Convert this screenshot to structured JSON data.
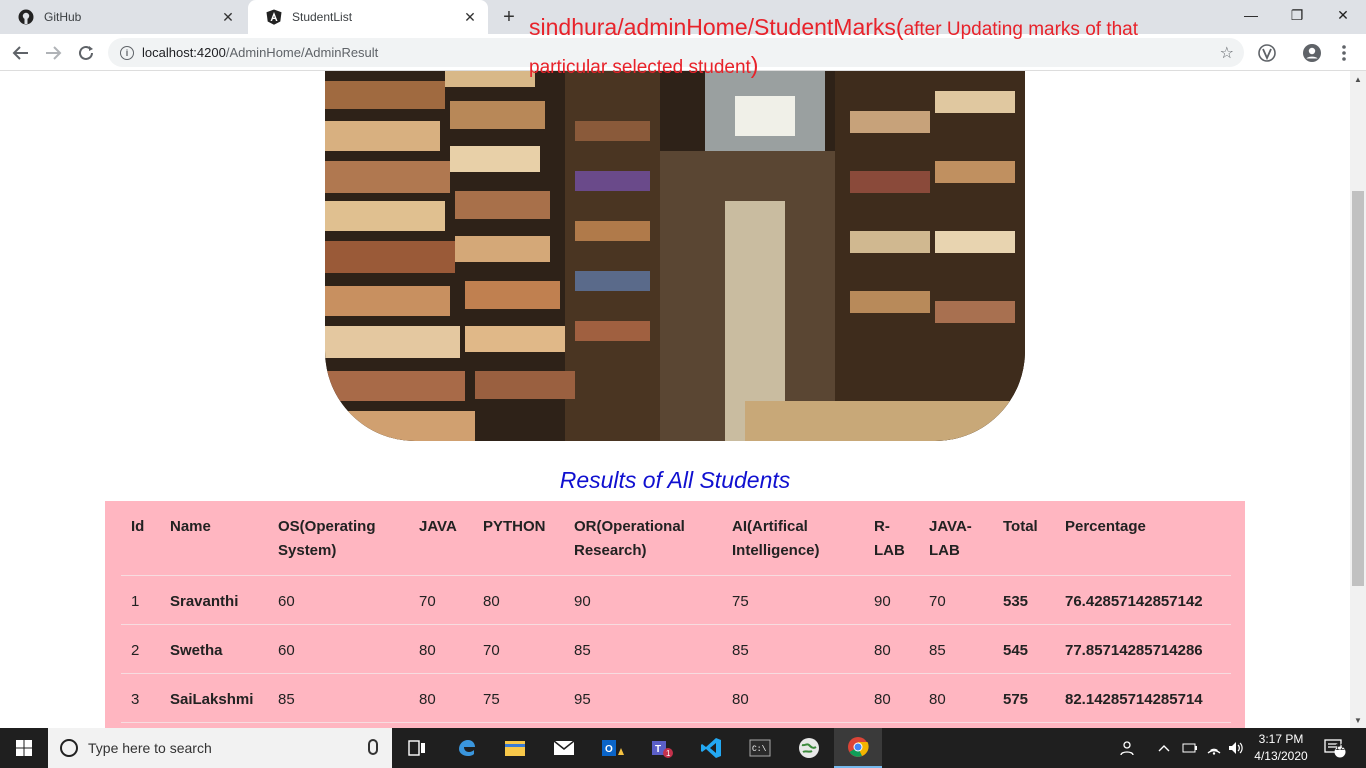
{
  "browser": {
    "tabs": [
      {
        "title": "GitHub",
        "active": false
      },
      {
        "title": "StudentList",
        "active": true
      }
    ],
    "url_host": "localhost:4200",
    "url_path": "/AdminHome/AdminResult"
  },
  "annotation": {
    "main": "sindhura/adminHome/StudentMarks(",
    "detail": "after Updating marks of that particular selected student",
    "close": ")",
    "color": "#e8222a"
  },
  "page": {
    "results_title": "Results of All Students",
    "title_color": "#1010d0",
    "table_bg": "#ffb6c1",
    "headers": {
      "id": "Id",
      "name": "Name",
      "os": "OS(Operating System)",
      "java": "JAVA",
      "python": "PYTHON",
      "or": "OR(Operational Research)",
      "ai": "AI(Artifical Intelligence)",
      "rlab": "R-LAB",
      "javalab": "JAVA-LAB",
      "total": "Total",
      "percentage": "Percentage"
    },
    "rows": [
      {
        "id": "1",
        "name": "Sravanthi",
        "os": "60",
        "java": "70",
        "python": "80",
        "or": "90",
        "ai": "75",
        "rlab": "90",
        "javalab": "70",
        "total": "535",
        "percentage": "76.42857142857142"
      },
      {
        "id": "2",
        "name": "Swetha",
        "os": "60",
        "java": "80",
        "python": "70",
        "or": "85",
        "ai": "85",
        "rlab": "80",
        "javalab": "85",
        "total": "545",
        "percentage": "77.85714285714286"
      },
      {
        "id": "3",
        "name": "SaiLakshmi",
        "os": "85",
        "java": "80",
        "python": "75",
        "or": "95",
        "ai": "80",
        "rlab": "80",
        "javalab": "80",
        "total": "575",
        "percentage": "82.14285714285714"
      }
    ]
  },
  "taskbar": {
    "search_placeholder": "Type here to search",
    "time": "3:17 PM",
    "date": "4/13/2020",
    "notification_count": "12"
  }
}
